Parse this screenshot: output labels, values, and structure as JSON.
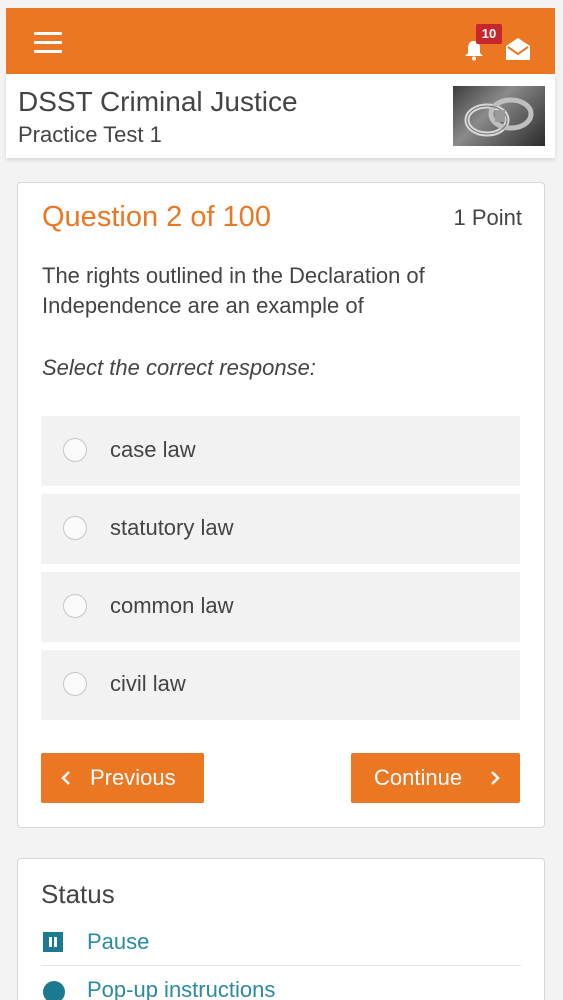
{
  "topbar": {
    "menu_icon": "hamburger-menu-icon",
    "notifications_icon": "bell-icon",
    "notifications_count": "10",
    "messages_icon": "envelope-icon",
    "background_color": "#ec7722"
  },
  "header": {
    "title": "DSST Criminal Justice",
    "subtitle": "Practice Test 1",
    "thumbnail": "handcuffs-image"
  },
  "question": {
    "number_label": "Question 2 of 100",
    "points": "1 Point",
    "text": "The rights outlined in the Declaration of Independence are an example of",
    "instruction": "Select the correct response:",
    "options": [
      {
        "label": "case law"
      },
      {
        "label": "statutory law"
      },
      {
        "label": "common law"
      },
      {
        "label": "civil law"
      }
    ],
    "previous_label": "Previous",
    "continue_label": "Continue",
    "accent_color": "#ec7722"
  },
  "status": {
    "title": "Status",
    "pause_label": "Pause",
    "popup_label": "Pop-up instructions",
    "link_color": "#2a8ba0"
  }
}
